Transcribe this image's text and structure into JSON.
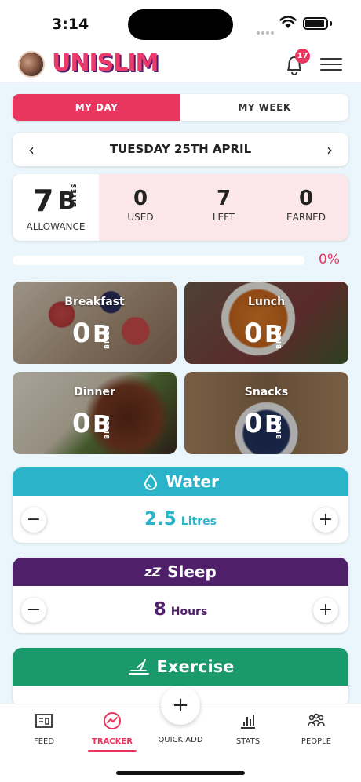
{
  "status_bar": {
    "time": "3:14"
  },
  "header": {
    "logo": "UNISLIM",
    "notifications": "17"
  },
  "segmented": {
    "my_day": "MY DAY",
    "my_week": "MY WEEK"
  },
  "date_nav": {
    "date": "TUESDAY 25TH APRIL"
  },
  "allowance": {
    "value": "7",
    "bites_mark": "B",
    "bites_word": "BITES",
    "label": "ALLOWANCE",
    "used": "0",
    "used_label": "USED",
    "left": "7",
    "left_label": "LEFT",
    "earned": "0",
    "earned_label": "EARNED"
  },
  "progress": {
    "percent_label": "0%",
    "fraction": 0
  },
  "meals": [
    {
      "name": "Breakfast",
      "value": "0",
      "mark": "B",
      "word": "BITES"
    },
    {
      "name": "Lunch",
      "value": "0",
      "mark": "B",
      "word": "BITES"
    },
    {
      "name": "Dinner",
      "value": "0",
      "mark": "B",
      "word": "BITES"
    },
    {
      "name": "Snacks",
      "value": "0",
      "mark": "B",
      "word": "BITES"
    }
  ],
  "water": {
    "title": "Water",
    "value": "2.5",
    "unit": "Litres",
    "color": "#2bb4c9"
  },
  "sleep": {
    "title": "Sleep",
    "value": "8",
    "unit": "Hours",
    "color": "#4f1f6a",
    "icon_text": "zZ"
  },
  "exercise": {
    "title": "Exercise",
    "color": "#1a9a6c"
  },
  "nav": {
    "feed": "FEED",
    "tracker": "TRACKER",
    "quick_add": "QUICK ADD",
    "stats": "STATS",
    "people": "PEOPLE"
  },
  "colors": {
    "accent": "#e8365f",
    "bg": "#eaf6fb"
  }
}
